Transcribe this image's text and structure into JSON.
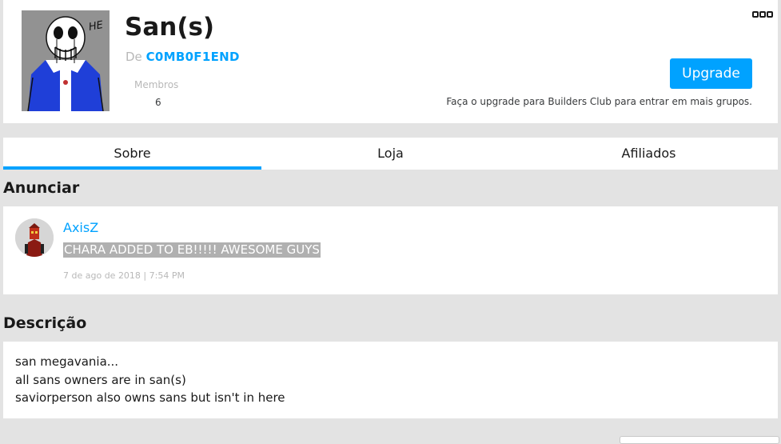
{
  "group": {
    "name": "San(s)",
    "owner_prefix": "De",
    "owner_name": "C0MB0F1END",
    "members_label": "Membros",
    "members_count": "6",
    "emblem_scrawl": "HE"
  },
  "upgrade": {
    "button_label": "Upgrade",
    "note": "Faça o upgrade para Builders Club para entrar em mais grupos."
  },
  "tabs": [
    {
      "label": "Sobre",
      "active": true
    },
    {
      "label": "Loja",
      "active": false
    },
    {
      "label": "Afiliados",
      "active": false
    }
  ],
  "shout": {
    "section_title": "Anunciar",
    "username": "AxisZ",
    "text": "CHARA ADDED TO EB!!!!! AWESOME GUYS",
    "date": "7 de ago de 2018 | 7:54 PM"
  },
  "description": {
    "section_title": "Descrição",
    "lines": [
      "san megavania...",
      "all sans owners are in san(s)",
      "saviorperson also owns sans but isn't in here"
    ]
  },
  "colors": {
    "accent": "#00a2ff",
    "page_bg": "#e3e3e3",
    "card_bg": "#ffffff",
    "muted_text": "#b8b8b8"
  },
  "icons": {
    "more": "more-options-icon"
  }
}
